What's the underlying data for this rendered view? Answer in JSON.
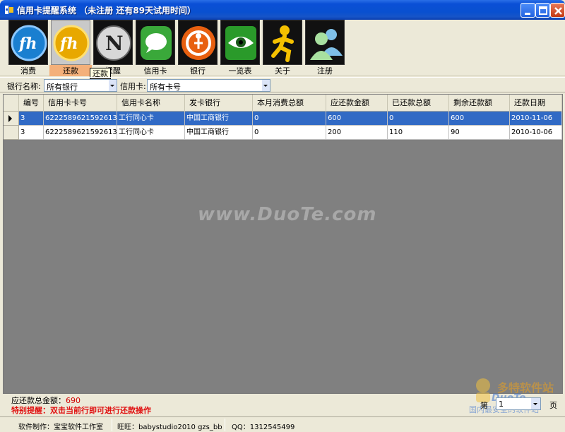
{
  "window": {
    "title": "信用卡提醒系统 （未注册 还有89天试用时间）"
  },
  "toolbar": {
    "items": [
      {
        "label": "消费",
        "icon": "flash-fh-icon"
      },
      {
        "label": "还款",
        "icon": "flash-fh-icon",
        "active": true
      },
      {
        "label": "提醒",
        "icon": "netscape-n-icon"
      },
      {
        "label": "信用卡",
        "icon": "chat-bubble-icon"
      },
      {
        "label": "银行",
        "icon": "figure-circle-icon"
      },
      {
        "label": "一览表",
        "icon": "eye-icon"
      },
      {
        "label": "关于",
        "icon": "running-man-icon"
      },
      {
        "label": "注册",
        "icon": "users-icon"
      }
    ],
    "tooltip": "还款"
  },
  "filters": {
    "bank_label": "银行名称:",
    "bank_value": "所有银行",
    "card_label": "信用卡:",
    "card_value": "所有卡号"
  },
  "grid": {
    "columns": [
      "编号",
      "信用卡卡号",
      "信用卡名称",
      "发卡银行",
      "本月消费总额",
      "应还款金额",
      "已还款总额",
      "剩余还款额",
      "还款日期"
    ],
    "rows": [
      [
        "3",
        "6222589621592613",
        "工行同心卡",
        "中国工商银行",
        "0",
        "600",
        "0",
        "600",
        "2010-11-06"
      ],
      [
        "3",
        "6222589621592613",
        "工行同心卡",
        "中国工商银行",
        "0",
        "200",
        "110",
        "90",
        "2010-10-06"
      ]
    ],
    "selected_row": 0,
    "watermark": "www.DuoTe.com"
  },
  "summary": {
    "label": "应还款总金额：",
    "amount": "690",
    "hint": "特别提醒：双击当前行即可进行还款操作"
  },
  "pager": {
    "prefix": "第",
    "value": "1",
    "suffix": "页"
  },
  "statusbar": {
    "author": "软件制作：宝宝软件工作室",
    "wangwang": "旺旺：babystudio2010  gzs_bb",
    "qq": "QQ：1312545499"
  },
  "logo_watermark": {
    "name": "多特软件站",
    "brand": "DuoTe",
    "tagline": "国内最安全的软件站"
  },
  "colors": {
    "titlebar": "#0a4fd6",
    "selection": "#316ac5",
    "amount": "#d00000",
    "hint": "#e01010"
  }
}
